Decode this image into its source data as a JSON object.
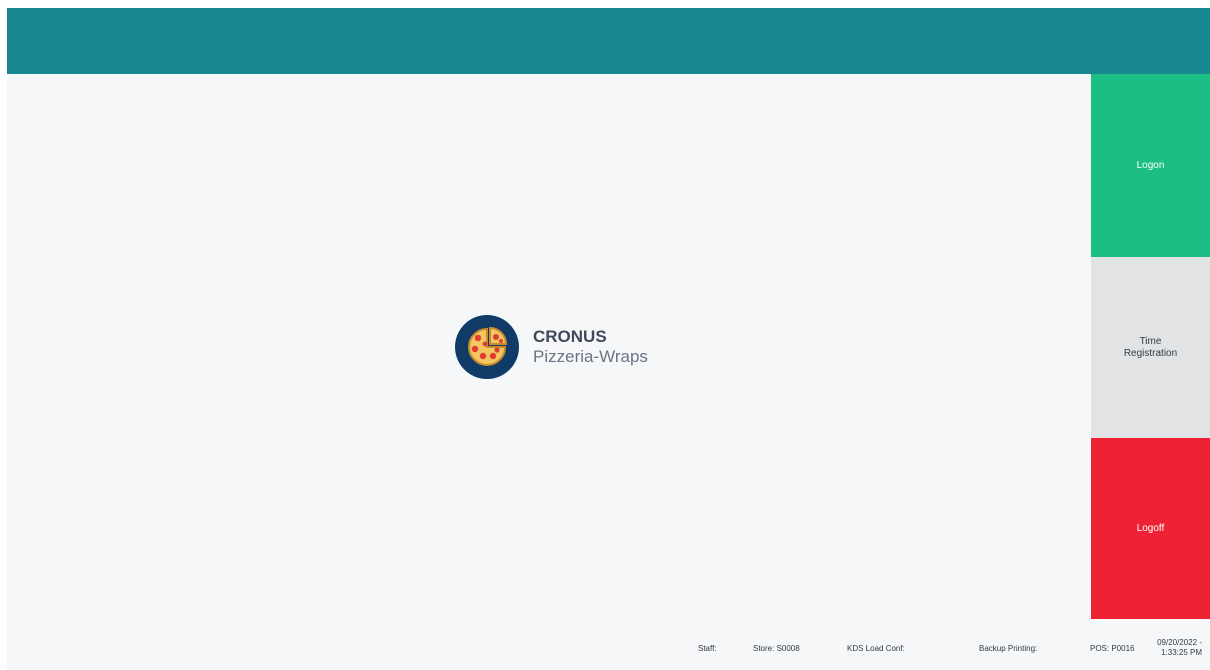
{
  "brand": {
    "name": "CRONUS",
    "subtitle": "Pizzeria-Wraps",
    "logo_icon": "pizza-icon"
  },
  "actions": {
    "logon": "Logon",
    "time_registration_line1": "Time",
    "time_registration_line2": "Registration",
    "logoff": "Logoff"
  },
  "status_bar": {
    "staff": "Staff:",
    "store": "Store: S0008",
    "kds_load_conf": "KDS Load Conf:",
    "backup_printing": "Backup Printing:",
    "pos": "POS: P0016",
    "date": "09/20/2022 -",
    "time": "1:33:25 PM"
  },
  "colors": {
    "header": "#17888f",
    "logon": "#1dbe84",
    "time_registration": "#e2e3e5",
    "logoff": "#ef2134",
    "logo_badge": "#0f3b66"
  }
}
